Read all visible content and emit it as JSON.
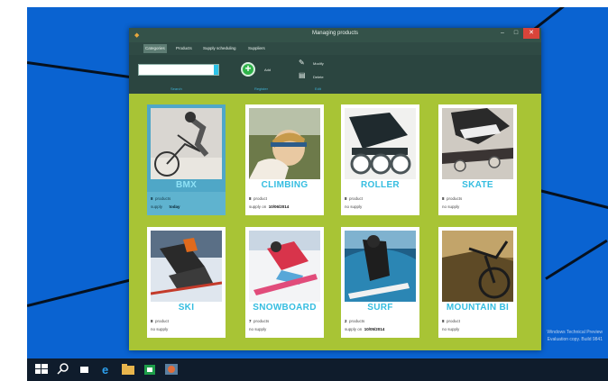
{
  "window": {
    "title": "Managing products",
    "controls": {
      "minimize": "–",
      "maximize": "□",
      "close": "✕"
    }
  },
  "tabs": [
    "Categories",
    "Products",
    "Supply scheduling",
    "Suppliers"
  ],
  "ribbon": {
    "search_value": "",
    "group_search": "Search",
    "add_label": "Add",
    "group_add": "Register",
    "modify_label": "Modify",
    "delete_label": "Delete",
    "group_edit": "Edit"
  },
  "categories": [
    {
      "name": "BMX",
      "count": "8",
      "count_label": "products",
      "supply_prefix": "supply",
      "supply_date": "today",
      "selected": true
    },
    {
      "name": "CLIMBING",
      "count": "8",
      "count_label": "product",
      "supply_prefix": "supply on",
      "supply_date": "10/06/2014",
      "selected": false
    },
    {
      "name": "ROLLER",
      "count": "8",
      "count_label": "product",
      "supply_prefix": "no supply",
      "supply_date": "",
      "selected": false
    },
    {
      "name": "SKATE",
      "count": "8",
      "count_label": "products",
      "supply_prefix": "no supply",
      "supply_date": "",
      "selected": false
    },
    {
      "name": "SKI",
      "count": "8",
      "count_label": "product",
      "supply_prefix": "no supply",
      "supply_date": "",
      "selected": false
    },
    {
      "name": "SNOWBOARD",
      "count": "7",
      "count_label": "products",
      "supply_prefix": "no supply",
      "supply_date": "",
      "selected": false
    },
    {
      "name": "SURF",
      "count": "2",
      "count_label": "products",
      "supply_prefix": "supply on",
      "supply_date": "10/05/2014",
      "selected": false
    },
    {
      "name": "MOUNTAIN BI",
      "count": "8",
      "count_label": "product",
      "supply_prefix": "no supply",
      "supply_date": "",
      "selected": false
    }
  ],
  "desktop": {
    "watermark_line1": "Windows Technical Preview",
    "watermark_line2": "Evaluation copy. Build 9841"
  },
  "taskbar": {
    "icons": [
      "windows-start-icon",
      "search-icon",
      "task-view-icon",
      "internet-explorer-icon",
      "file-explorer-icon",
      "store-icon",
      "app-icon"
    ]
  },
  "colors": {
    "desktop": "#0a63d1",
    "window": "#2f4a44",
    "content_bg": "#a8c435",
    "accent": "#35bde0",
    "close": "#d9443a"
  }
}
